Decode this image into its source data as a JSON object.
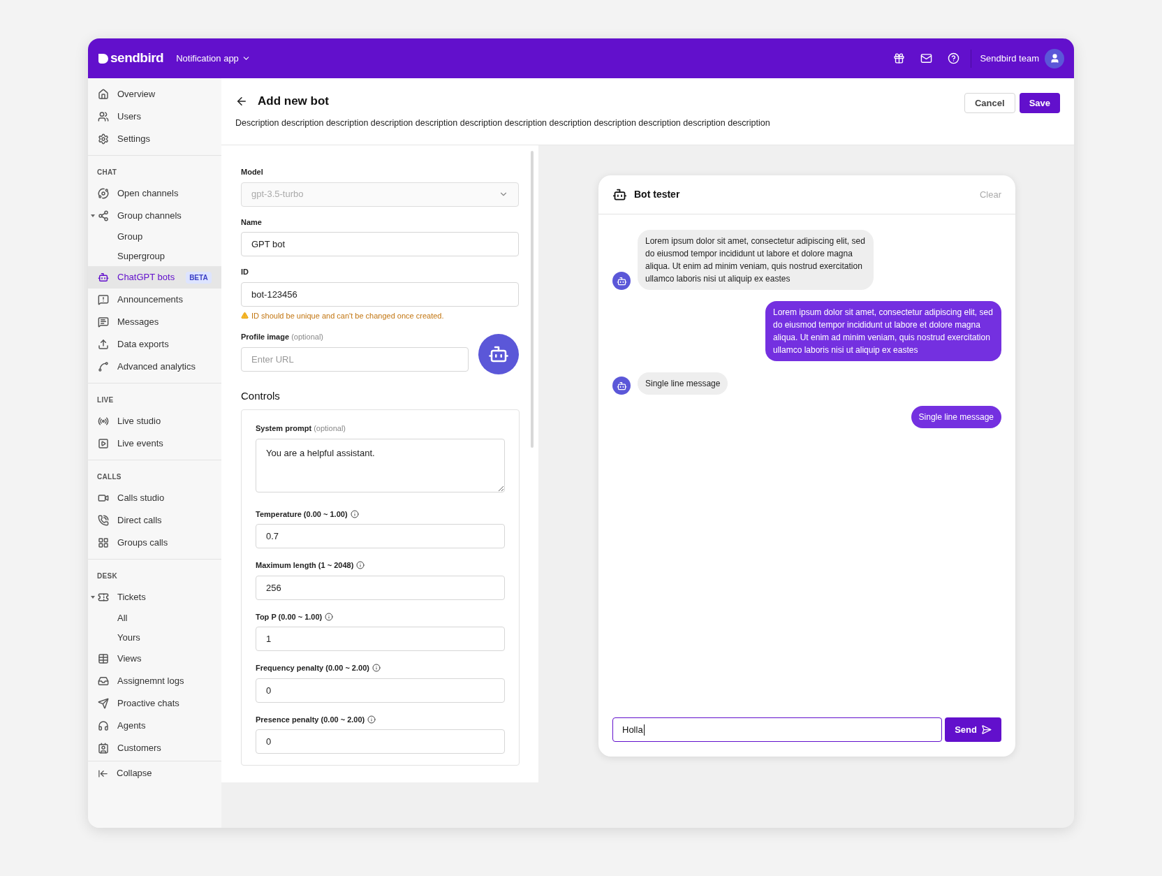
{
  "topbar": {
    "logo": "sendbird",
    "app_switcher": "Notification app",
    "user_name": "Sendbird team"
  },
  "sidebar": {
    "groups": [
      {
        "items": [
          {
            "label": "Overview",
            "selected": false
          },
          {
            "label": "Users",
            "selected": false
          },
          {
            "label": "Settings",
            "selected": false
          }
        ]
      },
      {
        "heading": "CHAT",
        "items": [
          {
            "label": "Open channels",
            "selected": false
          },
          {
            "label": "Group channels",
            "selected": false,
            "expanded": true,
            "children": [
              {
                "label": "Group",
                "selected": false
              },
              {
                "label": "Supergroup",
                "selected": false
              }
            ]
          },
          {
            "label": "ChatGPT bots",
            "selected": true,
            "badge": "BETA"
          },
          {
            "label": "Announcements",
            "selected": false
          },
          {
            "label": "Messages",
            "selected": false
          },
          {
            "label": "Data exports",
            "selected": false
          },
          {
            "label": "Advanced analytics",
            "selected": false
          }
        ]
      },
      {
        "heading": "LIVE",
        "items": [
          {
            "label": "Live studio",
            "selected": false
          },
          {
            "label": "Live events",
            "selected": false
          }
        ]
      },
      {
        "heading": "CALLS",
        "items": [
          {
            "label": "Calls studio",
            "selected": false
          },
          {
            "label": "Direct calls",
            "selected": false
          },
          {
            "label": "Groups calls",
            "selected": false
          }
        ]
      },
      {
        "heading": "DESK",
        "items": [
          {
            "label": "Tickets",
            "selected": false,
            "expanded": true,
            "children": [
              {
                "label": "All",
                "selected": false
              },
              {
                "label": "Yours",
                "selected": false
              }
            ]
          },
          {
            "label": "Views",
            "selected": false
          },
          {
            "label": "Assignemnt logs",
            "selected": false
          },
          {
            "label": "Proactive chats",
            "selected": false
          },
          {
            "label": "Agents",
            "selected": false
          },
          {
            "label": "Customers",
            "selected": false
          }
        ]
      }
    ],
    "collapse": "Collapse"
  },
  "page": {
    "title": "Add new bot",
    "description": "Description description description description description description description description description description description description",
    "buttons": [
      {
        "label": "Cancel",
        "kind": "secondary"
      },
      {
        "label": "Save",
        "kind": "primary"
      }
    ]
  },
  "form": {
    "fields": [
      {
        "label": "Model",
        "kind": "select",
        "value": "gpt-3.5-turbo",
        "disabled": true
      },
      {
        "label": "Name",
        "kind": "text",
        "value": "GPT bot"
      },
      {
        "label": "ID",
        "kind": "text",
        "value": "bot-123456",
        "warning": "ID should be unique and can't be changed once created."
      },
      {
        "label": "Profile image",
        "hint": "(optional)",
        "kind": "image",
        "placeholder": "Enter URL"
      }
    ],
    "controls": {
      "title": "Controls",
      "fields": [
        {
          "label": "System prompt",
          "hint": "(optional)",
          "kind": "textarea",
          "value": "You are a helpful assistant."
        },
        {
          "label": "Temperature (0.00 ~ 1.00)",
          "kind": "text",
          "value": "0.7",
          "info": true
        },
        {
          "label": "Maximum length (1 ~ 2048)",
          "kind": "text",
          "value": "256",
          "info": true
        },
        {
          "label": "Top P (0.00 ~ 1.00)",
          "kind": "text",
          "value": "1",
          "info": true
        },
        {
          "label": "Frequency penalty (0.00 ~ 2.00)",
          "kind": "text",
          "value": "0",
          "info": true
        },
        {
          "label": "Presence penalty (0.00 ~ 2.00)",
          "kind": "text",
          "value": "0",
          "info": true
        }
      ]
    }
  },
  "chat": {
    "title": "Bot tester",
    "clear": "Clear",
    "messages": [
      {
        "kind": "bot",
        "text": "Lorem ipsum dolor sit amet, consectetur adipiscing elit, sed do eiusmod tempor incididunt ut labore et dolore magna aliqua. Ut enim ad minim veniam, quis nostrud exercitation ullamco laboris nisi ut aliquip ex eastes"
      },
      {
        "kind": "user",
        "text": "Lorem ipsum dolor sit amet, consectetur adipiscing elit, sed do eiusmod tempor incididunt ut labore et dolore magna aliqua. Ut enim ad minim veniam, quis nostrud exercitation ullamco laboris nisi ut aliquip ex eastes"
      },
      {
        "kind": "bot",
        "text": "Single line message"
      },
      {
        "kind": "user",
        "text": "Single line message"
      }
    ],
    "input": {
      "value": "Holla"
    },
    "send": "Send"
  }
}
